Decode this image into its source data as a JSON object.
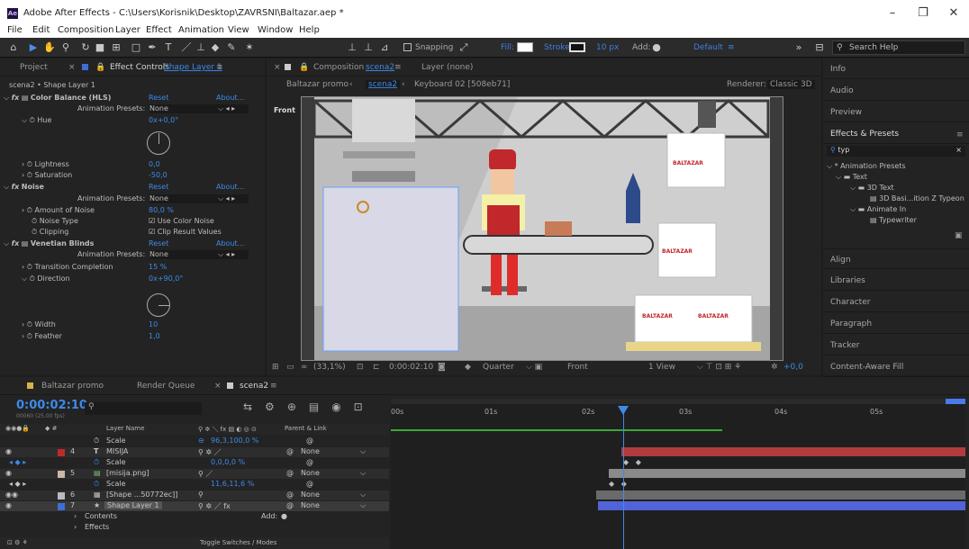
{
  "window": {
    "title": "Adobe After Effects - C:\\Users\\Korisnik\\Desktop\\ZAVRSNI\\Baltazar.aep *",
    "logo": "Ae",
    "minimize": "–",
    "maximize": "❐",
    "close": "✕"
  },
  "menu": [
    "File",
    "Edit",
    "Composition",
    "Layer",
    "Effect",
    "Animation",
    "View",
    "Window",
    "Help"
  ],
  "toolbar": {
    "snapping": "Snapping",
    "fill": "Fill:",
    "stroke": "Stroke:",
    "stroke_width": "10 px",
    "add": "Add:",
    "workspace": "Default",
    "search_placeholder": "Search Help",
    "fill_color": "#ffffff",
    "stroke_color": "#1c3a8c"
  },
  "left_panel": {
    "tab_project": "Project",
    "tab_effect_controls": "Effect Controls",
    "tab_effect_layer": "Shape Layer 1",
    "subheader": "scena2 • Shape Layer 1",
    "rows": [
      {
        "kind": "fx",
        "name": "Color Balance (HLS)",
        "reset": "Reset",
        "about": "About..."
      },
      {
        "kind": "preset",
        "label": "Animation Presets:",
        "value": "None"
      },
      {
        "kind": "param",
        "name": "Hue",
        "value": "0x+0,0°"
      },
      {
        "kind": "param",
        "name": "Lightness",
        "value": "0,0"
      },
      {
        "kind": "param",
        "name": "Saturation",
        "value": "-50,0"
      },
      {
        "kind": "fx",
        "name": "Noise",
        "reset": "Reset",
        "about": "About..."
      },
      {
        "kind": "preset",
        "label": "Animation Presets:",
        "value": "None"
      },
      {
        "kind": "param",
        "name": "Amount of Noise",
        "value": "80,0 %"
      },
      {
        "kind": "check",
        "name": "Noise Type",
        "value": "Use Color Noise"
      },
      {
        "kind": "check",
        "name": "Clipping",
        "value": "Clip Result Values"
      },
      {
        "kind": "fx",
        "name": "Venetian Blinds",
        "reset": "Reset",
        "about": "About..."
      },
      {
        "kind": "preset",
        "label": "Animation Presets:",
        "value": "None"
      },
      {
        "kind": "param",
        "name": "Transition Completion",
        "value": "15 %"
      },
      {
        "kind": "param",
        "name": "Direction",
        "value": "0x+90,0°"
      },
      {
        "kind": "param",
        "name": "Width",
        "value": "10"
      },
      {
        "kind": "param",
        "name": "Feather",
        "value": "1,0"
      }
    ]
  },
  "composition": {
    "tab_label": "Composition",
    "tab_comp": "scena2",
    "tab_layer": "Layer (none)",
    "breadcrumb": [
      "Baltazar promo",
      "scena2",
      "Keyboard 02 [508eb71]"
    ],
    "renderer_label": "Renderer:",
    "renderer": "Classic 3D",
    "view_label": "Front",
    "zoom": "(33,1%)",
    "timecode": "0:00:02:10",
    "resolution": "Quarter",
    "view": "Front",
    "views": "1 View",
    "exposure": "+0,0",
    "box_text": "BALTAZAR"
  },
  "right_panel": {
    "items": [
      "Info",
      "Audio",
      "Preview",
      "Effects & Presets"
    ],
    "search_value": "typ",
    "tree": [
      "* Animation Presets",
      "Text",
      "3D Text",
      "3D Basi...ition Z Typeon",
      "Animate In",
      "Typewriter"
    ],
    "items2": [
      "Align",
      "Libraries",
      "Character",
      "Paragraph",
      "Tracker",
      "Content-Aware Fill"
    ]
  },
  "timeline": {
    "tabs": [
      "Baltazar promo",
      "Render Queue",
      "scena2"
    ],
    "timecode": "0:00:02:10",
    "timecode_sub": "00060 (25.00 fps)",
    "col_layer_name": "Layer Name",
    "col_parent": "Parent & Link",
    "ruler": [
      "00s",
      "01s",
      "02s",
      "03s",
      "04s",
      "05s"
    ],
    "rows": [
      {
        "num": "",
        "name": "Scale",
        "switches": "",
        "value": "96,3,100,0 %",
        "parent": ""
      },
      {
        "num": "4",
        "name": "MISIJA",
        "switches": "",
        "value": "",
        "parent": "None"
      },
      {
        "num": "",
        "name": "Scale",
        "switches": "",
        "value": "0,0,0,0 %",
        "parent": ""
      },
      {
        "num": "5",
        "name": "[misija.png]",
        "switches": "",
        "value": "",
        "parent": "None"
      },
      {
        "num": "",
        "name": "Scale",
        "switches": "",
        "value": "11,6,11,6 %",
        "parent": ""
      },
      {
        "num": "6",
        "name": "[Shape ...50772ec]]",
        "switches": "",
        "value": "",
        "parent": "None"
      },
      {
        "num": "7",
        "name": "Shape Layer 1",
        "switches": "",
        "value": "",
        "parent": "None"
      },
      {
        "num": "",
        "name": "Contents",
        "switches": "",
        "value": "Add:",
        "parent": ""
      },
      {
        "num": "",
        "name": "Effects",
        "switches": "",
        "value": "",
        "parent": ""
      }
    ],
    "toggle_label": "Toggle Switches / Modes"
  }
}
